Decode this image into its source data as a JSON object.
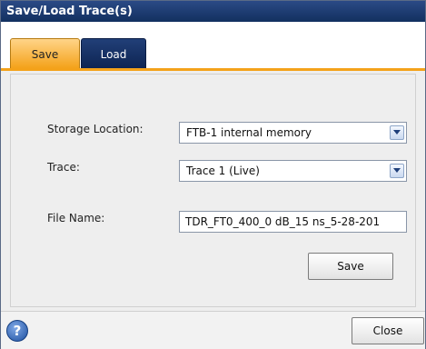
{
  "window": {
    "title": "Save/Load Trace(s)"
  },
  "tabs": [
    {
      "label": "Save",
      "active": true
    },
    {
      "label": "Load",
      "active": false
    }
  ],
  "form": {
    "storage_location": {
      "label": "Storage Location:",
      "value": "FTB-1 internal memory"
    },
    "trace": {
      "label": "Trace:",
      "value": "Trace 1 (Live)"
    },
    "file_name": {
      "label": "File Name:",
      "value": "TDR_FT0_400_0 dB_15 ns_5-28-201"
    },
    "save_label": "Save"
  },
  "footer": {
    "help_glyph": "?",
    "close_label": "Close"
  },
  "colors": {
    "title_bar": "#1b3a72",
    "active_tab": "#f4a21a",
    "inactive_tab": "#142f63"
  }
}
